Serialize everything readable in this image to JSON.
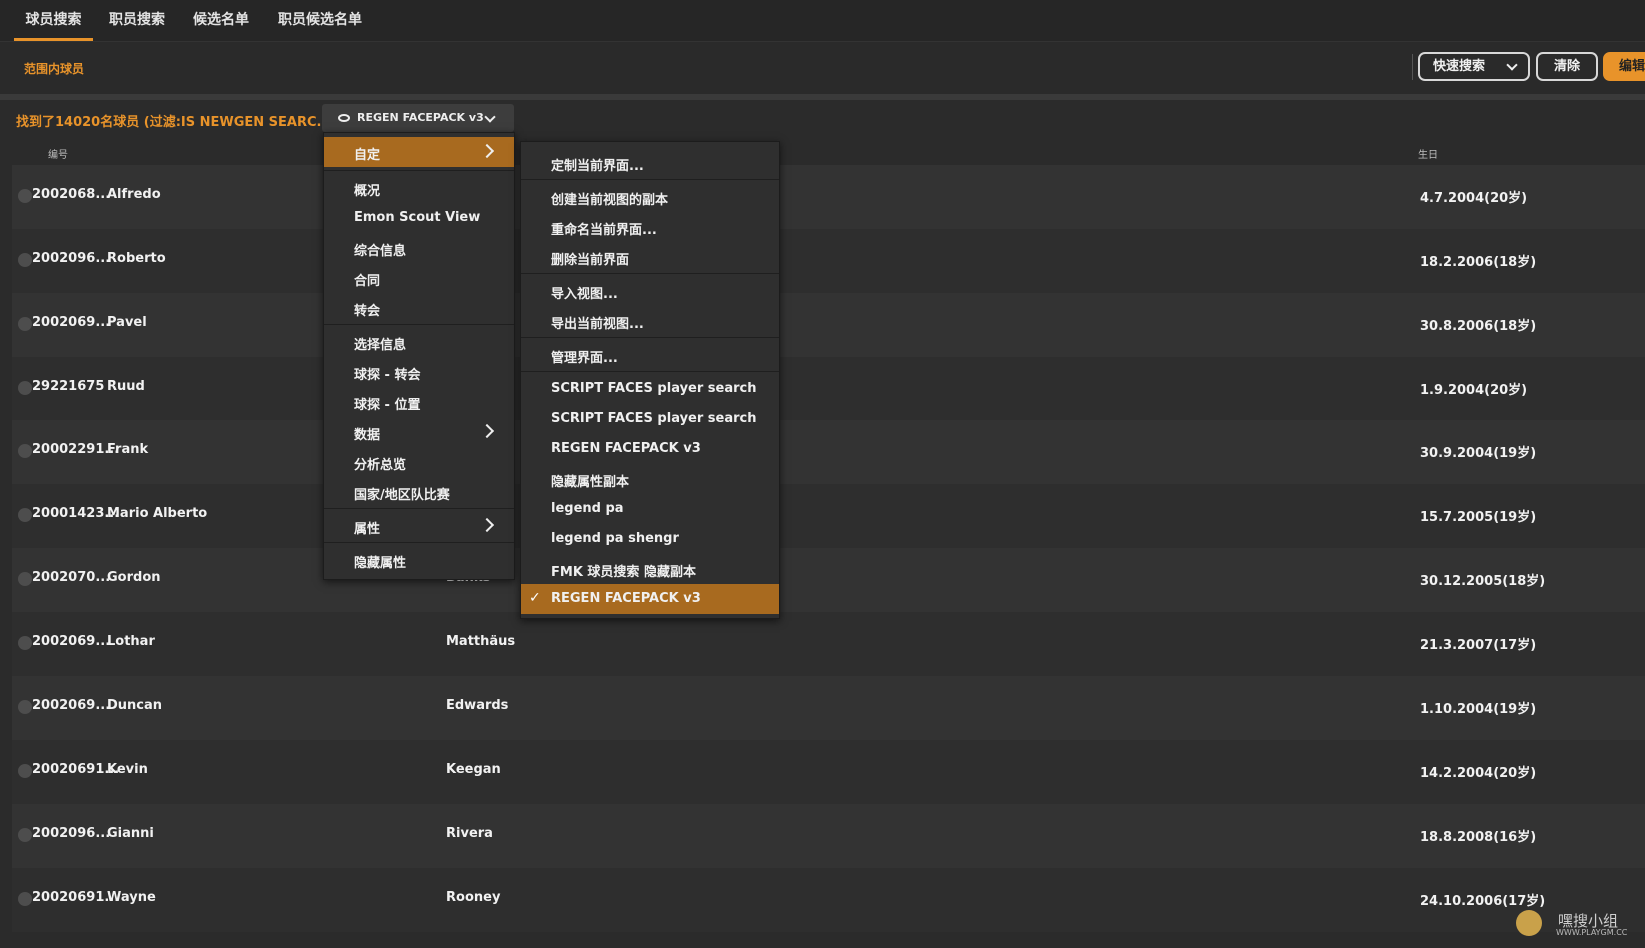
{
  "tabs": [
    "球员搜索",
    "职员搜索",
    "候选名单",
    "职员候选名单"
  ],
  "scope_label": "范围内球员",
  "toolbar": {
    "quick_search": "快速搜索",
    "clear": "清除",
    "edit": "编辑"
  },
  "found_text": "找到了14020名球员 (过滤:IS NEWGEN SEARC...)",
  "view_button": "REGEN FACEPACK v3",
  "columns": {
    "id": "编号",
    "birth": "生日"
  },
  "rows": [
    {
      "id": "2002068...",
      "first": "Alfredo",
      "last": "",
      "birth": "4.7.2004(20岁)"
    },
    {
      "id": "2002096...",
      "first": "Roberto",
      "last": "",
      "birth": "18.2.2006(18岁)"
    },
    {
      "id": "2002069...",
      "first": "Pavel",
      "last": "",
      "birth": "30.8.2006(18岁)"
    },
    {
      "id": "29221675",
      "first": "Ruud",
      "last": "",
      "birth": "1.9.2004(20岁)"
    },
    {
      "id": "20002291...",
      "first": "Frank",
      "last": "",
      "birth": "30.9.2004(19岁)"
    },
    {
      "id": "20001423...",
      "first": "Mario Alberto",
      "last": "",
      "birth": "15.7.2005(19岁)"
    },
    {
      "id": "2002070...",
      "first": "Gordon",
      "last": "Banks",
      "birth": "30.12.2005(18岁)"
    },
    {
      "id": "2002069...",
      "first": "Lothar",
      "last": "Matthäus",
      "birth": "21.3.2007(17岁)"
    },
    {
      "id": "2002069...",
      "first": "Duncan",
      "last": "Edwards",
      "birth": "1.10.2004(19岁)"
    },
    {
      "id": "20020691...",
      "first": "Kevin",
      "last": "Keegan",
      "birth": "14.2.2004(20岁)"
    },
    {
      "id": "2002096...",
      "first": "Gianni",
      "last": "Rivera",
      "birth": "18.8.2008(16岁)"
    },
    {
      "id": "20020691...",
      "first": "Wayne",
      "last": "Rooney",
      "birth": "24.10.2006(17岁)"
    }
  ],
  "menu1": {
    "items": [
      "自定",
      "概况",
      "Emon Scout View",
      "综合信息",
      "合同",
      "转会",
      "选择信息",
      "球探 - 转会",
      "球探 - 位置",
      "数据",
      "分析总览",
      "国家/地区队比赛",
      "属性",
      "隐藏属性"
    ]
  },
  "menu2": {
    "items": [
      "定制当前界面...",
      "创建当前视图的副本",
      "重命名当前界面...",
      "删除当前界面",
      "导入视图...",
      "导出当前视图...",
      "管理界面...",
      "SCRIPT FACES  player search",
      "SCRIPT FACES  player search",
      "REGEN FACEPACK v3",
      "隐藏属性副本",
      "legend pa",
      "legend pa shengr",
      "FMK 球员搜索 隐藏副本",
      "REGEN FACEPACK v3"
    ],
    "checked_index": 14
  },
  "watermark": {
    "title": "嘿搜小组",
    "url": "WWW.PLAYGM.CC"
  },
  "colors": {
    "accent": "#e8932a",
    "selected": "#a86a1f",
    "background": "#2b2b2b"
  }
}
